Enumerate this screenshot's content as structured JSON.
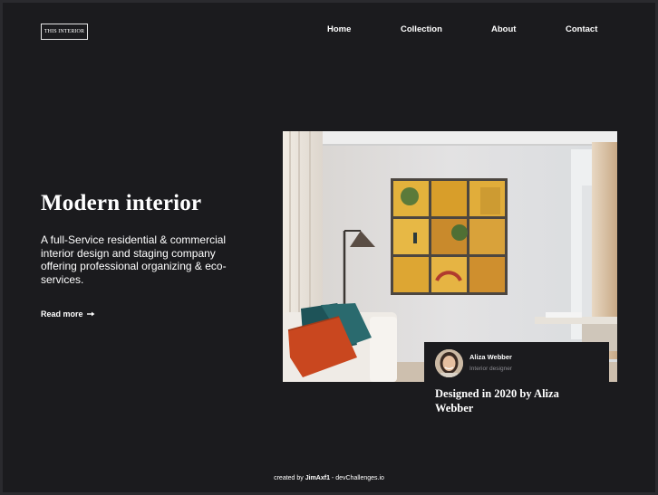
{
  "header": {
    "logo": "THIS INTERIOR",
    "nav": [
      "Home",
      "Collection",
      "About",
      "Contact"
    ]
  },
  "hero": {
    "title": "Modern interior",
    "description": "A full-Service residential & commercial interior design and staging company offering professional organizing & eco-services.",
    "cta": "Read more"
  },
  "card": {
    "name": "Aliza Webber",
    "role": "Interior designer",
    "title": "Designed in 2020 by Aliza Webber"
  },
  "footer": {
    "prefix": "created by",
    "author": "JimAxf1",
    "separator": " - ",
    "site": "devChallenges.io"
  },
  "icons": {
    "cta_icon": "arrow-right-icon"
  },
  "colors": {
    "background": "#1b1b1e",
    "text": "#ffffff",
    "muted": "#8c8c92"
  }
}
